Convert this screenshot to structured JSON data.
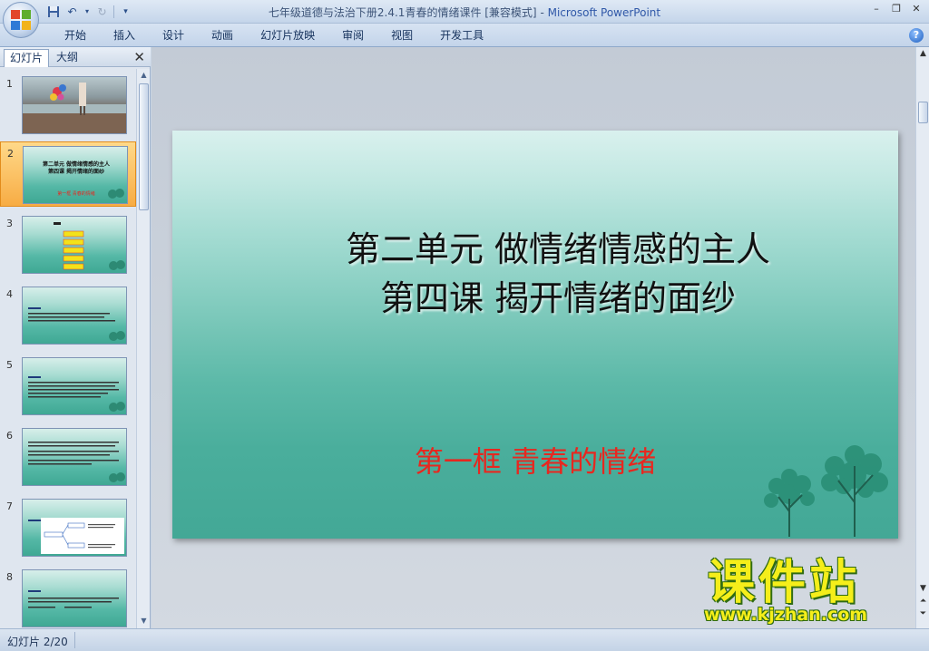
{
  "window": {
    "title": "七年级道德与法治下册2.4.1青春的情绪课件 [兼容模式]",
    "separator": " - ",
    "app_name": "Microsoft PowerPoint"
  },
  "ribbon": {
    "tabs": [
      "开始",
      "插入",
      "设计",
      "动画",
      "幻灯片放映",
      "审阅",
      "视图",
      "开发工具"
    ]
  },
  "left_pane": {
    "tab_slides": "幻灯片",
    "tab_outline": "大纲",
    "close": "✕",
    "thumbnails": [
      {
        "num": "1"
      },
      {
        "num": "2",
        "line1": "第二单元 做情绪情感的主人",
        "line2": "第四课 揭开情绪的面纱",
        "line3": "第一框 青春的情绪"
      },
      {
        "num": "3"
      },
      {
        "num": "4"
      },
      {
        "num": "5"
      },
      {
        "num": "6"
      },
      {
        "num": "7"
      },
      {
        "num": "8"
      }
    ]
  },
  "slide": {
    "title_line1": "第二单元 做情绪情感的主人",
    "title_line2": "第四课 揭开情绪的面纱",
    "subtitle": "第一框 青春的情绪"
  },
  "watermark": {
    "text": "课件站",
    "url": "www.kjzhan.com"
  },
  "status": {
    "slide_counter": "幻灯片 2/20"
  },
  "colors": {
    "selected_thumb": "#f7ac44",
    "subtitle": "#e8271f",
    "watermark": "#f5ee1a"
  }
}
